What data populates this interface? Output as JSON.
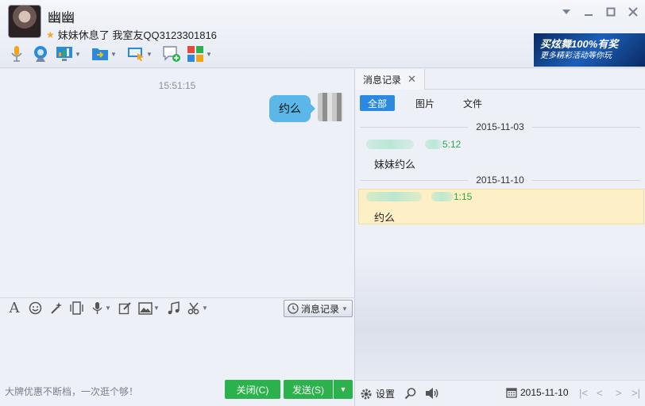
{
  "header": {
    "contact_name": "幽幽",
    "signature": "妹妹休息了 我室友QQ3123301816",
    "ad_line1": "买炫舞100%有奖",
    "ad_line2": "更多精彩活动等你玩",
    "window_controls": [
      "chevron-down-icon",
      "minimize-icon",
      "maximize-icon",
      "close-icon"
    ],
    "toolbar_icons": [
      "microphone-icon",
      "webcam-icon",
      "remote-screen-icon",
      "file-transfer-icon",
      "screen-share-icon",
      "new-discussion-icon",
      "apps-grid-icon"
    ]
  },
  "chat": {
    "time": "15:51:15",
    "message": "约么"
  },
  "input_tools": {
    "icons": [
      "font-icon",
      "emoji-icon",
      "magic-wand-icon",
      "shake-icon",
      "voice-icon",
      "edit-icon",
      "image-icon",
      "music-icon",
      "scissors-icon"
    ],
    "history_button": "消息记录"
  },
  "bottom": {
    "promo": "大牌优惠不断档，一次逛个够！",
    "close_label": "关闭(C)",
    "send_label": "发送(S)"
  },
  "history": {
    "tab_label": "消息记录",
    "filters": [
      "全部",
      "图片",
      "文件"
    ],
    "groups": [
      {
        "date": "2015-11-03",
        "time_suffix": "5:12",
        "text": "妹妹约么"
      },
      {
        "date": "2015-11-10",
        "time_suffix": "1:15",
        "text": "约么"
      }
    ],
    "settings_label": "设置",
    "current_date": "2015-11-10"
  },
  "colors": {
    "accent_green": "#2bb24c",
    "accent_blue": "#2b8ae0",
    "bubble": "#5ab7e8",
    "highlight": "#fdf0c6"
  }
}
